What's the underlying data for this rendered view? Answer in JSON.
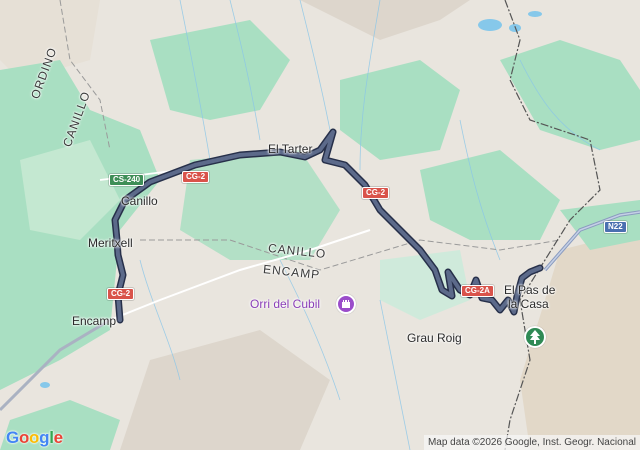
{
  "map": {
    "places": {
      "el_tarter": "El Tarter",
      "canillo_town": "Canillo",
      "meritxell": "Meritxell",
      "encamp_town": "Encamp",
      "el_pas": "El Pas de",
      "el_pas_2": "la Casa",
      "grau_roig": "Grau Roig"
    },
    "parishes": {
      "ordino": "ORDINO",
      "canillo_nw": "CANILLO",
      "canillo": "CANILLO",
      "encamp": "ENCAMP"
    },
    "poi": {
      "orri": "Orri del Cubil",
      "icon": "castle-icon"
    },
    "park_icon": "tree-icon",
    "shields": {
      "cs240": "CS-240",
      "cg2_a": "CG-2",
      "cg2_b": "CG-2",
      "cg2_c": "CG-2",
      "cg2a": "CG-2A",
      "n22": "N22"
    },
    "colors": {
      "route": "#4a5570",
      "route_outline": "#27304a",
      "forest": "#a9dfc2",
      "terrain": "#e8e4dd",
      "water": "#86c8ea",
      "road_red": "#d9534a"
    }
  },
  "footer": {
    "logo_letters": [
      "G",
      "o",
      "o",
      "g",
      "l",
      "e"
    ],
    "attribution": "Map data ©2026 Google, Inst. Geogr. Nacional"
  }
}
